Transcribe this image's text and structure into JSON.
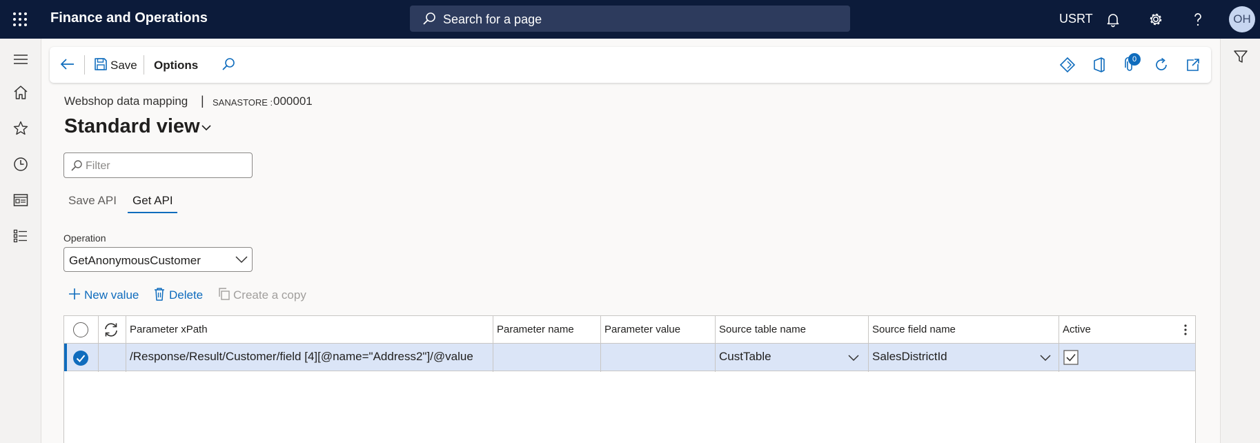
{
  "app": {
    "title": "Finance and Operations",
    "search_placeholder": "Search for a page",
    "company": "USRT",
    "user_initials": "OH"
  },
  "icons": {
    "top": [
      "waffle-icon",
      "search-icon",
      "bell-icon",
      "gear-icon",
      "help-icon"
    ],
    "nav": [
      "hamburger-icon",
      "home-icon",
      "star-icon",
      "clock-icon",
      "workspace-icon",
      "list-icon"
    ],
    "action_right": [
      "power-apps-icon",
      "office-icon",
      "attachment-icon",
      "refresh-icon",
      "open-new-icon"
    ],
    "right_pane": [
      "filter-icon"
    ]
  },
  "action_pane": {
    "save_label": "Save",
    "options_label": "Options",
    "attachment_count": "0"
  },
  "page": {
    "breadcrumb": "Webshop data mapping",
    "separator": "|",
    "company_key": "SANASTORE : ",
    "record_id": "000001",
    "view_name": "Standard view",
    "filter_placeholder": "Filter"
  },
  "tabs": [
    {
      "label": "Save API",
      "active": false
    },
    {
      "label": "Get API",
      "active": true
    }
  ],
  "operation": {
    "label": "Operation",
    "value": "GetAnonymousCustomer"
  },
  "grid_toolbar": {
    "new_value": "New value",
    "delete": "Delete",
    "create_copy": "Create a copy"
  },
  "grid": {
    "columns": [
      "Parameter xPath",
      "Parameter name",
      "Parameter value",
      "Source table name",
      "Source field name",
      "Active"
    ],
    "rows": [
      {
        "selected": true,
        "parameter_xpath": "/Response/Result/Customer/field [4][@name=\"Address2\"]/@value",
        "parameter_name": "",
        "parameter_value": "",
        "source_table_name": "CustTable",
        "source_field_name": "SalesDistrictId",
        "active": true
      }
    ]
  },
  "colors": {
    "topbar": "#0c1b3a",
    "accent": "#0f6cbd",
    "selected_row": "#dbe5f7"
  }
}
